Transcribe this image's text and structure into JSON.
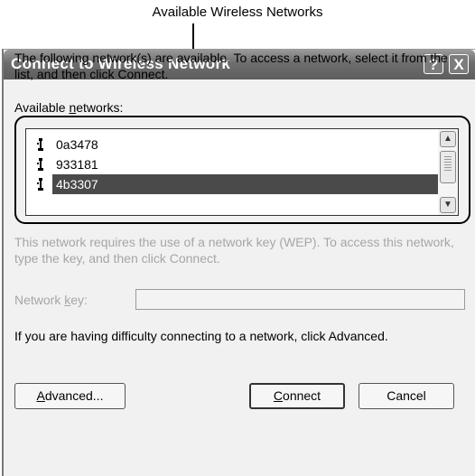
{
  "caption": "Available Wireless Networks",
  "dialog": {
    "title": "Connect to Wireless Network",
    "help_glyph": "?",
    "close_glyph": "X",
    "intro_text": "The following network(s) are available. To access a network, select it from the list, and then click Connect.",
    "networks_label_pre": "Available ",
    "networks_label_u": "n",
    "networks_label_post": "etworks:",
    "networks": [
      "0a3478",
      "933181",
      "4b3307"
    ],
    "selected_network": "4b3307",
    "wep_text": "This network requires the use of a network key (WEP). To access this network, type the key, and then click Connect.",
    "key_label_pre": "Network ",
    "key_label_u": "k",
    "key_label_post": "ey:",
    "key_value": "",
    "difficulty_text": "If you are having difficulty connecting to a network, click Advanced.",
    "advanced_pre": "",
    "advanced_u": "A",
    "advanced_post": "dvanced...",
    "connect_pre": "",
    "connect_u": "C",
    "connect_post": "onnect",
    "cancel_label": "Cancel"
  }
}
